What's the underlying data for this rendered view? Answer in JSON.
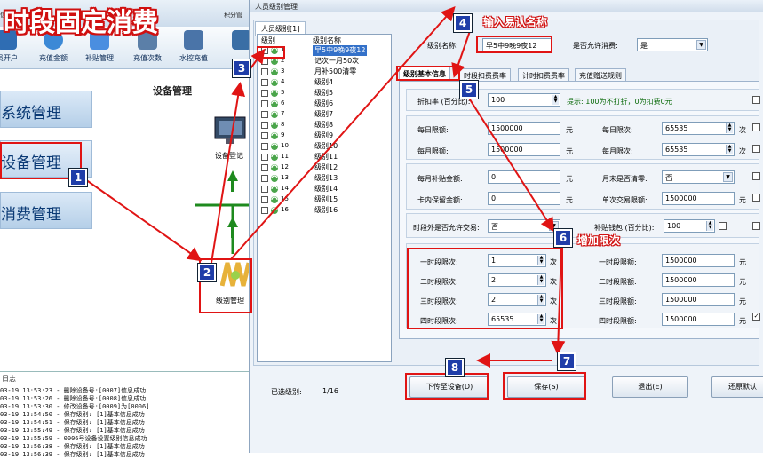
{
  "annotation": {
    "title": "时段固定消费",
    "step4_text": "输入易认名称",
    "step6_text": "增加限次",
    "badges": [
      "1",
      "2",
      "3",
      "4",
      "5",
      "6",
      "7",
      "8"
    ]
  },
  "background_app": {
    "top_labels": [
      "信息",
      "积分管"
    ],
    "toolbar": [
      "员开户",
      "充值金额",
      "补贴管理",
      "充值次数",
      "水控充值"
    ],
    "nav": [
      "系统管理",
      "设备管理",
      "消费管理"
    ],
    "device_panel_title": "设备管理",
    "device_icon_label": "设备登记",
    "level_icon_label": "级别管理",
    "log_title": "日志",
    "log_lines": [
      "03-19 13:53:23 - 删除设备号:[0007]信息成功",
      "03-19 13:53:26 - 删除设备号:[0008]信息成功",
      "03-19 13:53:30 - 修改设备号:[0009]为[0006]",
      "03-19 13:54:50 - 保存级别: [1]基本信息成功",
      "03-19 13:54:51 - 保存级别: [1]基本信息成功",
      "03-19 13:55:49 - 保存级别: [1]基本信息成功",
      "03-19 13:55:59 - 0006号设备设置级别信息成功",
      "03-19 13:56:38 - 保存级别: [1]基本信息成功",
      "03-19 13:56:39 - 保存级别: [1]基本信息成功"
    ]
  },
  "window": {
    "title": "人员级别管理",
    "group_tab": "人员级别[1]",
    "list_headers": [
      "级别",
      "级别名称"
    ],
    "levels": [
      {
        "num": "1",
        "name": "早5中9晚9夜12",
        "checked": true,
        "selected": true
      },
      {
        "num": "2",
        "name": "记次一月50次",
        "checked": false
      },
      {
        "num": "3",
        "name": "月补500清零",
        "checked": false
      },
      {
        "num": "4",
        "name": "级别4",
        "checked": false
      },
      {
        "num": "5",
        "name": "级别5",
        "checked": false
      },
      {
        "num": "6",
        "name": "级别6",
        "checked": false
      },
      {
        "num": "7",
        "name": "级别7",
        "checked": false
      },
      {
        "num": "8",
        "name": "级别8",
        "checked": false
      },
      {
        "num": "9",
        "name": "级别9",
        "checked": false
      },
      {
        "num": "10",
        "name": "级别10",
        "checked": false
      },
      {
        "num": "11",
        "name": "级别11",
        "checked": false
      },
      {
        "num": "12",
        "name": "级别12",
        "checked": false
      },
      {
        "num": "13",
        "name": "级别13",
        "checked": false
      },
      {
        "num": "14",
        "name": "级别14",
        "checked": false
      },
      {
        "num": "15",
        "name": "级别15",
        "checked": false
      },
      {
        "num": "16",
        "name": "级别16",
        "checked": false
      }
    ],
    "level_name_label": "级别名称:",
    "level_name_value": "早5中9晚9夜12",
    "allow_consume_label": "是否允许消费:",
    "allow_consume_value": "是",
    "tabs": [
      "级别基本信息",
      "时段扣费费率",
      "计时扣费费率",
      "充值赠送规则"
    ],
    "discount_label": "折扣率 (百分比):",
    "discount_value": "100",
    "discount_hint": "提示: 100为不打折，0为扣费0元",
    "daily_limit_label": "每日限额:",
    "daily_limit_value": "1500000",
    "daily_times_label": "每日限次:",
    "daily_times_value": "65535",
    "monthly_limit_label": "每月限额:",
    "monthly_limit_value": "1500000",
    "monthly_times_label": "每月限次:",
    "monthly_times_value": "65535",
    "monthly_subsidy_label": "每月补贴金额:",
    "monthly_subsidy_value": "0",
    "month_end_clear_label": "月末是否清零:",
    "month_end_clear_value": "否",
    "card_reserve_label": "卡内保留金额:",
    "card_reserve_value": "0",
    "single_limit_label": "单次交易限额:",
    "single_limit_value": "1500000",
    "outside_period_label": "时段外是否允许交易:",
    "outside_period_value": "否",
    "subsidy_wallet_label": "补贴钱包 (百分比):",
    "subsidy_wallet_value": "100",
    "unit_yuan": "元",
    "unit_times": "次",
    "periods": [
      {
        "times_label": "一时段限次:",
        "times": "1",
        "limit_label": "一时段限额:",
        "limit": "1500000"
      },
      {
        "times_label": "二时段限次:",
        "times": "2",
        "limit_label": "二时段限额:",
        "limit": "1500000"
      },
      {
        "times_label": "三时段限次:",
        "times": "2",
        "limit_label": "三时段限额:",
        "limit": "1500000"
      },
      {
        "times_label": "四时段限次:",
        "times": "65535",
        "limit_label": "四时段限额:",
        "limit": "1500000"
      }
    ],
    "selected_count_label": "已选级别:",
    "selected_count_value": "1/16",
    "btn_download": "下传至设备(D)",
    "btn_save": "保存(S)",
    "btn_exit": "退出(E)",
    "btn_restore": "还原默认"
  },
  "colors": {
    "annotation_red": "#e01414",
    "badge_blue": "#1f3da8",
    "selection_blue": "#3471c9"
  }
}
